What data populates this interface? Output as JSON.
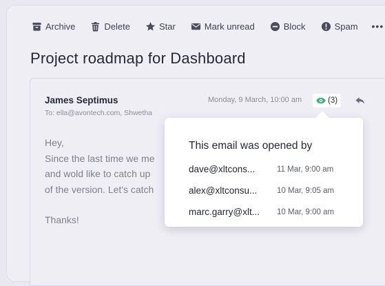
{
  "toolbar": {
    "archive": "Archive",
    "delete": "Delete",
    "star": "Star",
    "mark_unread": "Mark unread",
    "block": "Block",
    "spam": "Spam",
    "more": "•••"
  },
  "email": {
    "subject": "Project roadmap for Dashboard",
    "sender": "James Septimus",
    "to": "To: ella@avontech.com, Shwetha",
    "date": "Monday, 9 March, 10:00 am",
    "opens_count": "(3)",
    "body": [
      "Hey,",
      "Since the last time we me",
      "and wold like to catch up",
      "of the version. Let's catch"
    ],
    "signoff": "Thanks!"
  },
  "popup": {
    "title": "This email was opened by",
    "rows": [
      {
        "email": "dave@xltcons...",
        "time": "11 Mar, 9:00 am"
      },
      {
        "email": "alex@xltconsu...",
        "time": "10 Mar, 9:05 am"
      },
      {
        "email": "marc.garry@xlt...",
        "time": "10 Mar, 9:00 am"
      }
    ]
  },
  "colors": {
    "eye_icon": "#3fb27f",
    "text_dark": "#262836",
    "text_muted": "#8a8c99"
  }
}
